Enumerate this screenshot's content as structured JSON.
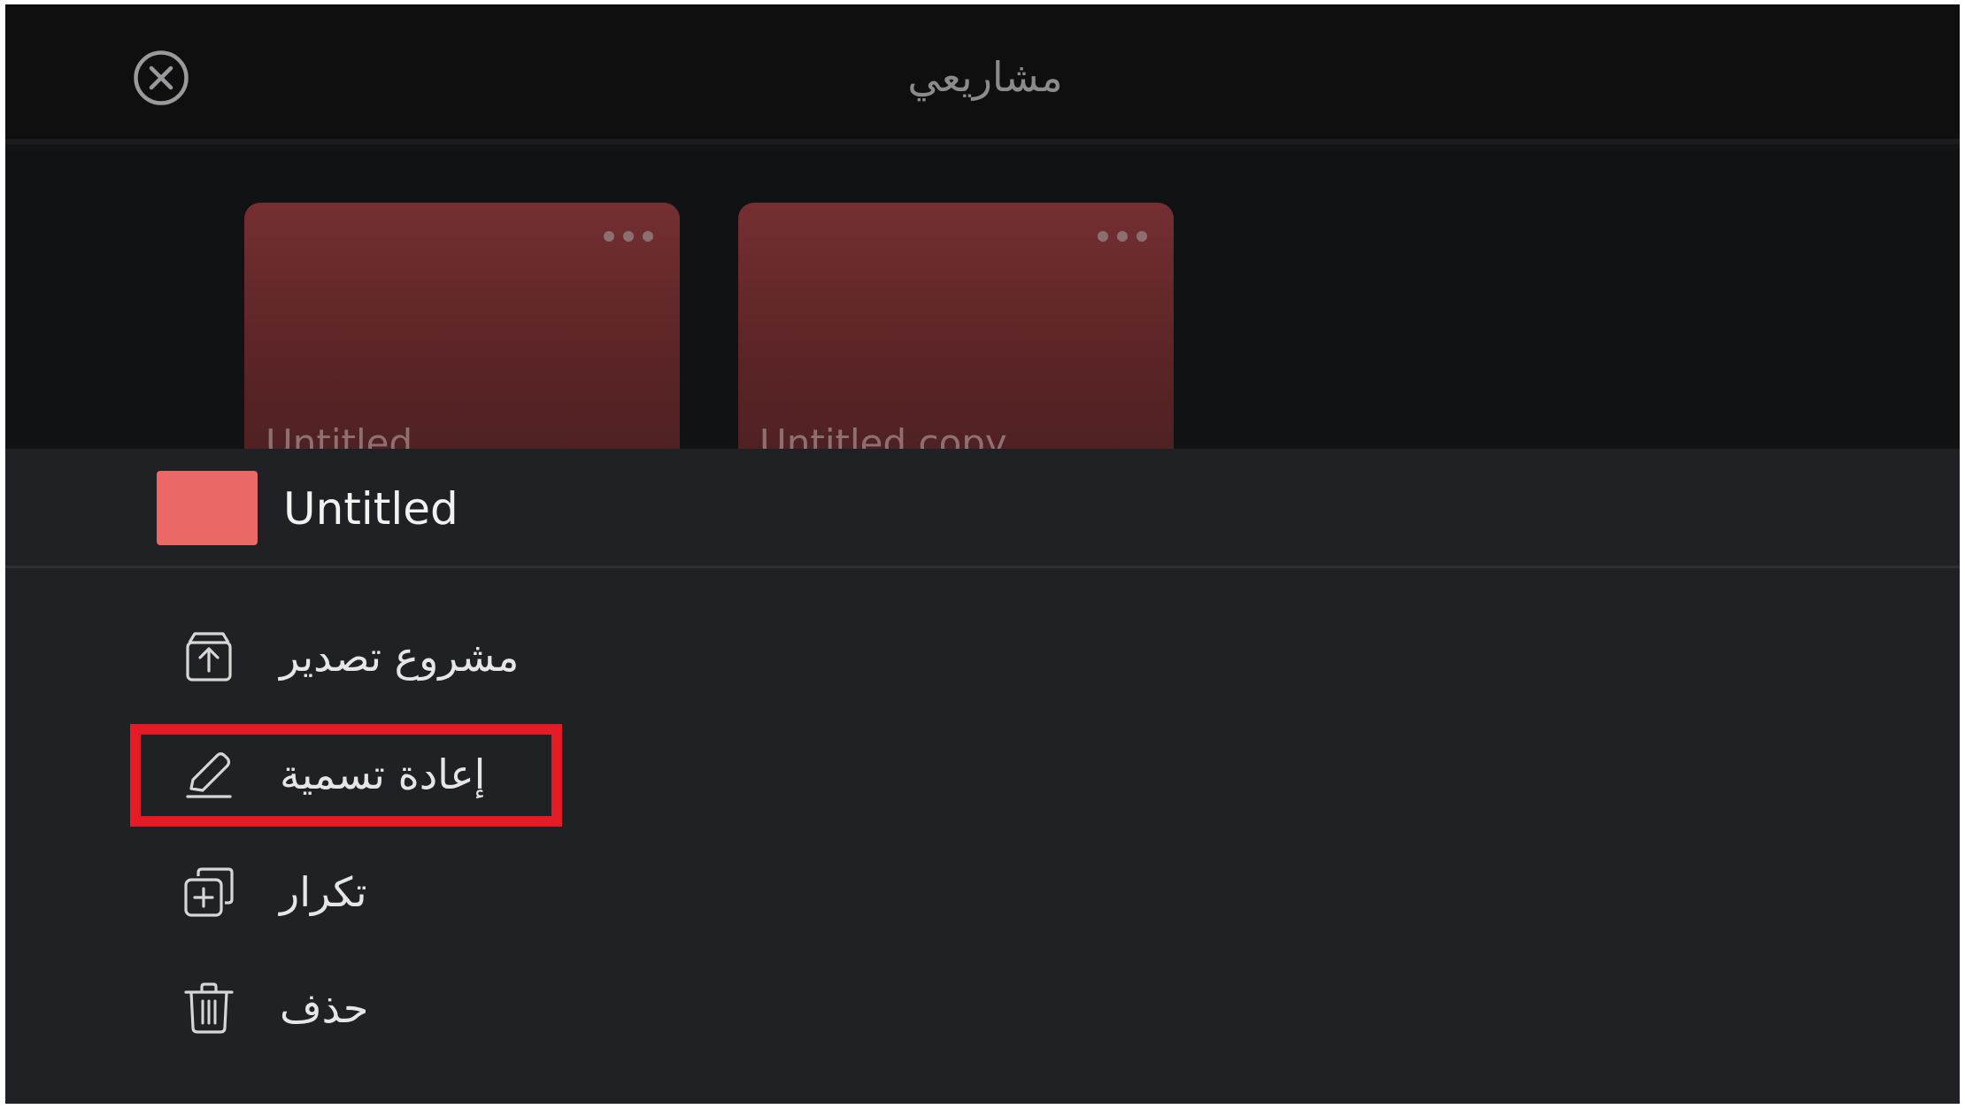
{
  "header": {
    "title": "مشاريعي",
    "close_icon": "close-circle-icon"
  },
  "projects": [
    {
      "title": "Untitled",
      "more_icon": "more-dots-icon"
    },
    {
      "title": "Untitled copy",
      "more_icon": "more-dots-icon"
    }
  ],
  "sheet": {
    "project_title": "Untitled",
    "swatch_color": "#ea6866",
    "items": [
      {
        "label": "مشروع تصدير",
        "icon": "export-icon"
      },
      {
        "label": "إعادة تسمية",
        "icon": "pencil-icon"
      },
      {
        "label": "تكرار",
        "icon": "duplicate-icon"
      },
      {
        "label": "حذف",
        "icon": "trash-icon"
      }
    ]
  },
  "colors": {
    "background": "#131416",
    "sheet": "#202124",
    "card": "#742f31",
    "highlight": "#e41c25"
  }
}
